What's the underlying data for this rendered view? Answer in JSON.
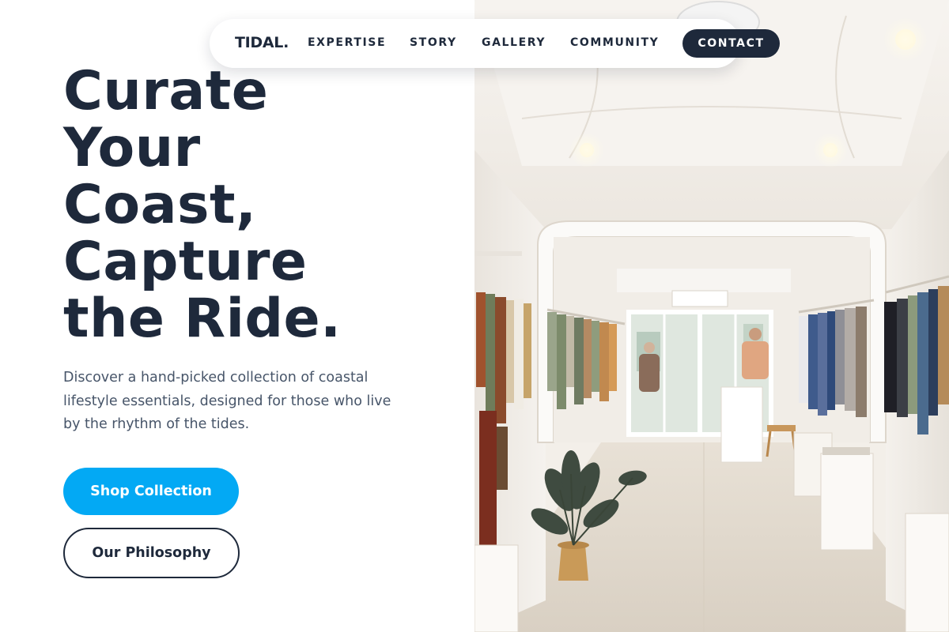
{
  "nav": {
    "logo": "TIDAL.",
    "links": [
      "EXPERTISE",
      "STORY",
      "GALLERY",
      "COMMUNITY"
    ],
    "contact_label": "CONTACT"
  },
  "hero": {
    "headline_lines": [
      "Curate",
      "Your",
      "Coast,",
      "Capture",
      "the Ride."
    ],
    "subtext": "Discover a hand-picked collection of coastal lifestyle essentials, designed for those who live by the rhythm of the tides.",
    "primary_button": "Shop Collection",
    "secondary_button": "Our Philosophy",
    "photo_icon": "boutique-interior-photo"
  },
  "colors": {
    "navy": "#1e293b",
    "accent": "#03a9f4",
    "body_text": "#475569",
    "background": "#ffffff"
  }
}
